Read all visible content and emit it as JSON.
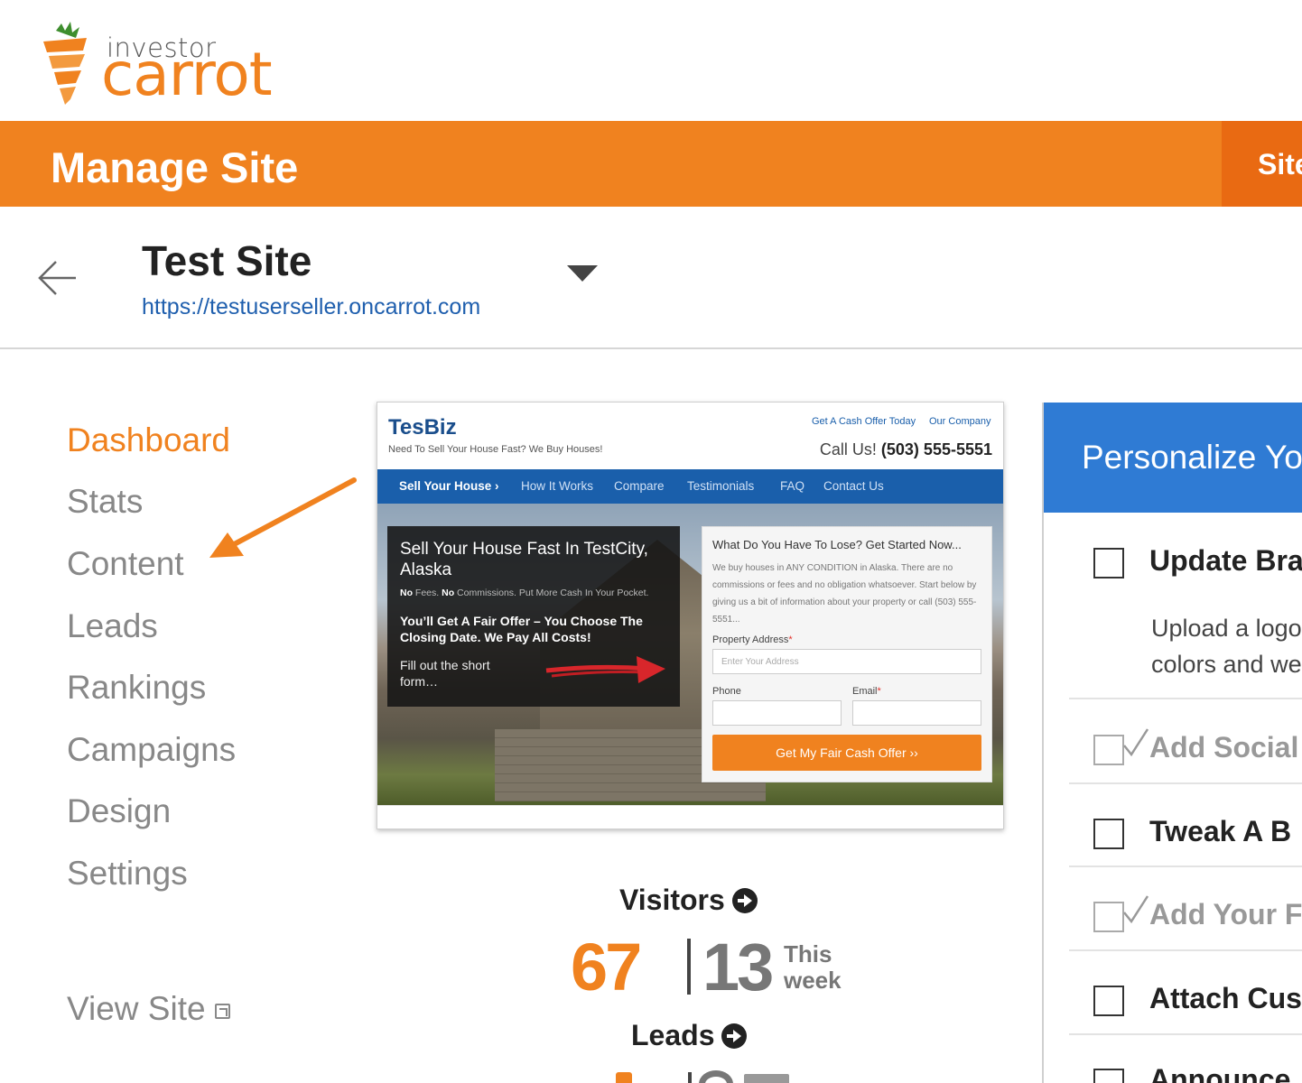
{
  "brand": {
    "name_small": "investor",
    "name_big": "carrot",
    "colors": {
      "orange": "#f0821f",
      "orange_dark": "#e96a12",
      "blue": "#2f7bd4",
      "link": "#1f5fae"
    }
  },
  "topbar": {
    "title": "Manage Site",
    "tab_label": "Site"
  },
  "site": {
    "name": "Test Site",
    "url": "https://testuserseller.oncarrot.com",
    "back_icon": "arrow-left-icon",
    "dropdown_icon": "caret-down-icon"
  },
  "sidebar": {
    "items": [
      {
        "label": "Dashboard",
        "active": true
      },
      {
        "label": "Stats",
        "active": false
      },
      {
        "label": "Content",
        "active": false
      },
      {
        "label": "Leads",
        "active": false
      },
      {
        "label": "Rankings",
        "active": false
      },
      {
        "label": "Campaigns",
        "active": false
      },
      {
        "label": "Design",
        "active": false
      },
      {
        "label": "Settings",
        "active": false
      }
    ],
    "view_site": "View Site",
    "view_site_icon": "external-link-icon"
  },
  "preview": {
    "brand": "TesBiz",
    "tagline": "Need To Sell Your House Fast? We Buy Houses!",
    "top_links": [
      "Get A Cash Offer Today",
      "Our Company"
    ],
    "call_prefix": "Call Us!",
    "phone": "(503) 555-5551",
    "nav": [
      "Sell Your House ›",
      "How It Works",
      "Compare",
      "Testimonials",
      "FAQ",
      "Contact Us"
    ],
    "hero_title": "Sell Your House Fast In TestCity, Alaska",
    "hero_sub_no1": "No",
    "hero_sub_fees": " Fees. ",
    "hero_sub_no2": "No",
    "hero_sub_rest": " Commissions. Put More Cash In Your Pocket.",
    "hero_bold": "You’ll Get A Fair Offer – You Choose The Closing Date. We Pay All Costs!",
    "hero_fill": "Fill out the short form…",
    "form_title": "What Do You Have To Lose? Get Started Now...",
    "form_text": "We buy houses in ANY CONDITION in Alaska. There are no commissions or fees and no obligation whatsoever. Start below by giving us a bit of information about your property or call (503) 555-5551...",
    "address_label": "Property Address",
    "address_placeholder": "Enter Your Address",
    "phone_label": "Phone",
    "email_label": "Email",
    "required_mark": "*",
    "submit_label": "Get My Fair Cash Offer ››"
  },
  "stats": {
    "visitors_label": "Visitors",
    "visitors_total": "67",
    "visitors_week": "13",
    "week_label_line1": "This",
    "week_label_line2": "week",
    "leads_label": "Leads",
    "go_icon": "arrow-circle-right-icon"
  },
  "panel": {
    "title": "Personalize Yo",
    "tasks": [
      {
        "title": "Update Bra",
        "done": false,
        "desc_line1": "Upload a logo",
        "desc_line2": "colors and we"
      },
      {
        "title": "Add Social",
        "done": true
      },
      {
        "title": "Tweak A B",
        "done": false
      },
      {
        "title": "Add Your F",
        "done": true
      },
      {
        "title": "Attach Cus",
        "done": false
      },
      {
        "title": "Announce",
        "done": false
      }
    ]
  }
}
